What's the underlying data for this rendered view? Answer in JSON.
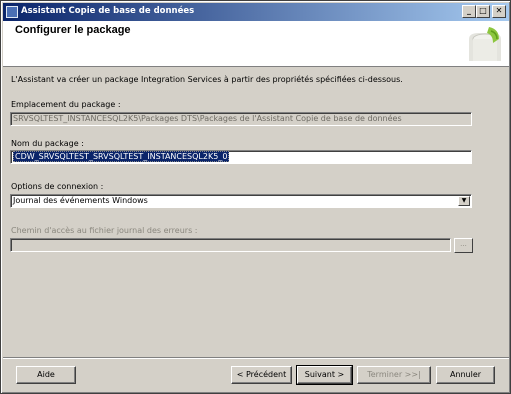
{
  "window": {
    "title": "Assistant Copie de base de données",
    "minimize_glyph": "_",
    "maximize_glyph": "□",
    "close_glyph": "✕"
  },
  "header": {
    "title": "Configurer le package"
  },
  "intro_text": "L'Assistant va créer un package Integration Services à partir des propriétés spécifiées ci-dessous.",
  "package_location": {
    "label": "Emplacement du package :",
    "value": "SRVSQLTEST_INSTANCESQL2K5\\Packages DTS\\Packages de l'Assistant Copie de base de données"
  },
  "package_name": {
    "label": "Nom du package :",
    "value": "CDW_SRVSQLTEST_SRVSQLTEST_INSTANCESQL2K5_0"
  },
  "logging_options": {
    "label": "Options de connexion :",
    "selected": "Journal des événements Windows",
    "arrow_glyph": "▼"
  },
  "error_log_path": {
    "label": "Chemin d'accès au fichier journal des erreurs :",
    "value": "",
    "browse_label": "..."
  },
  "buttons": {
    "help": "Aide",
    "previous": "< Précédent",
    "next": "Suivant >",
    "finish": "Terminer >>|",
    "cancel": "Annuler"
  },
  "colors": {
    "titlebar_start": "#0a246a",
    "titlebar_end": "#a6caf0",
    "dialog_face": "#d4d0c8",
    "selection": "#0a246a"
  }
}
